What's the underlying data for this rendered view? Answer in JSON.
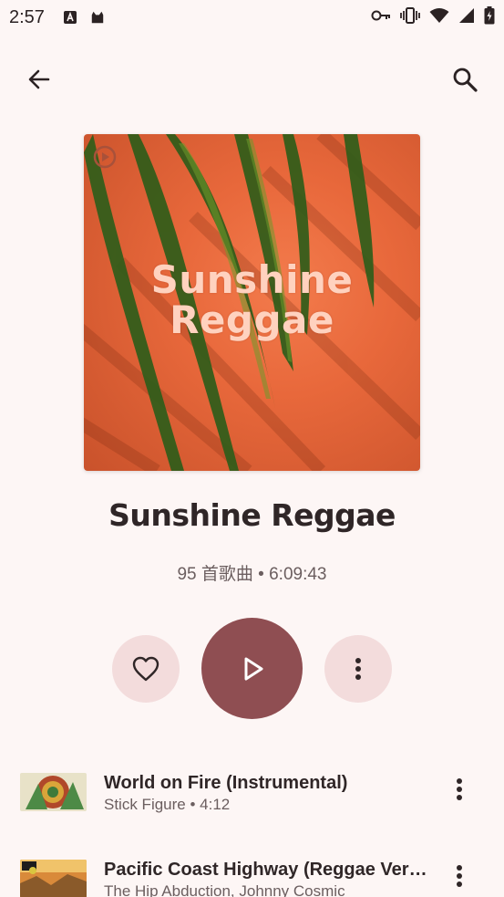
{
  "status_bar": {
    "time": "2:57",
    "icons": [
      "a-badge-icon",
      "cat-icon",
      "vpn-key-icon",
      "vibrate-icon",
      "wifi-icon",
      "signal-icon",
      "battery-charging-icon"
    ]
  },
  "top_bar": {
    "back_icon": "arrow-back-icon",
    "search_icon": "search-icon"
  },
  "cover": {
    "title": "Sunshine\nReggae",
    "colors": {
      "background": "#e8683b",
      "text": "#ffd2bf",
      "leaf": "#2f5d1a"
    }
  },
  "playlist": {
    "title": "Sunshine Reggae",
    "meta": "95 首歌曲 • 6:09:43"
  },
  "actions": {
    "like_icon": "heart-outline-icon",
    "play_icon": "play-icon",
    "more_icon": "more-vert-icon",
    "colors": {
      "primary": "#8f4e52",
      "tonal": "#f3dcdc"
    }
  },
  "tracks": [
    {
      "title": "World on Fire (Instrumental)",
      "subtitle": "Stick Figure • 4:12"
    },
    {
      "title": "Pacific Coast Highway (Reggae Version)",
      "subtitle": "The Hip Abduction, Johnny Cosmic"
    }
  ]
}
